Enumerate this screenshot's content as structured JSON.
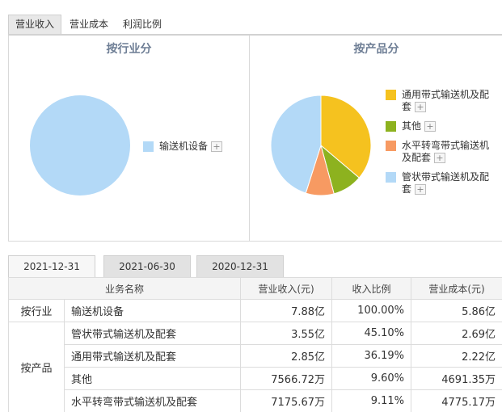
{
  "top_tabs": [
    {
      "label": "营业收入",
      "active": true
    },
    {
      "label": "营业成本",
      "active": false
    },
    {
      "label": "利润比例",
      "active": false
    }
  ],
  "charts": {
    "by_industry": {
      "title": "按行业分",
      "legend": [
        {
          "label": "输送机设备",
          "color": "#b3d9f7"
        }
      ],
      "chart_data": {
        "type": "pie",
        "title": "按行业分",
        "slices": [
          {
            "label": "输送机设备",
            "value": 100.0,
            "color": "#b3d9f7"
          }
        ]
      }
    },
    "by_product": {
      "title": "按产品分",
      "legend": [
        {
          "label_line1": "通用带式输送机及配",
          "label_line2": "套",
          "color": "#f5c21f"
        },
        {
          "label_line1": "其他",
          "label_line2": "",
          "color": "#8db21f"
        },
        {
          "label_line1": "水平转弯带式输送机",
          "label_line2": "及配套",
          "color": "#f79a62"
        },
        {
          "label_line1": "管状带式输送机及配",
          "label_line2": "套",
          "color": "#b3d9f7"
        }
      ],
      "chart_data": {
        "type": "pie",
        "title": "按产品分",
        "slices": [
          {
            "label": "通用带式输送机及配套",
            "value": 36.19,
            "color": "#f5c21f"
          },
          {
            "label": "其他",
            "value": 9.6,
            "color": "#8db21f"
          },
          {
            "label": "水平转弯带式输送机及配套",
            "value": 9.11,
            "color": "#f79a62"
          },
          {
            "label": "管状带式输送机及配套",
            "value": 45.1,
            "color": "#b3d9f7"
          }
        ]
      }
    }
  },
  "plus_symbol": "+",
  "date_tabs": [
    {
      "label": "2021-12-31",
      "active": true
    },
    {
      "label": "2021-06-30",
      "active": false
    },
    {
      "label": "2020-12-31",
      "active": false
    }
  ],
  "table": {
    "headers": [
      "业务名称",
      "营业收入(元)",
      "收入比例",
      "营业成本(元)"
    ],
    "groups": {
      "industry": "按行业",
      "product": "按产品"
    },
    "rows": [
      {
        "name": "输送机设备",
        "revenue": "7.88亿",
        "ratio": "100.00%",
        "cost": "5.86亿"
      },
      {
        "name": "管状带式输送机及配套",
        "revenue": "3.55亿",
        "ratio": "45.10%",
        "cost": "2.69亿"
      },
      {
        "name": "通用带式输送机及配套",
        "revenue": "2.85亿",
        "ratio": "36.19%",
        "cost": "2.22亿"
      },
      {
        "name": "其他",
        "revenue": "7566.72万",
        "ratio": "9.60%",
        "cost": "4691.35万"
      },
      {
        "name": "水平转弯带式输送机及配套",
        "revenue": "7175.67万",
        "ratio": "9.11%",
        "cost": "4775.17万"
      }
    ]
  }
}
